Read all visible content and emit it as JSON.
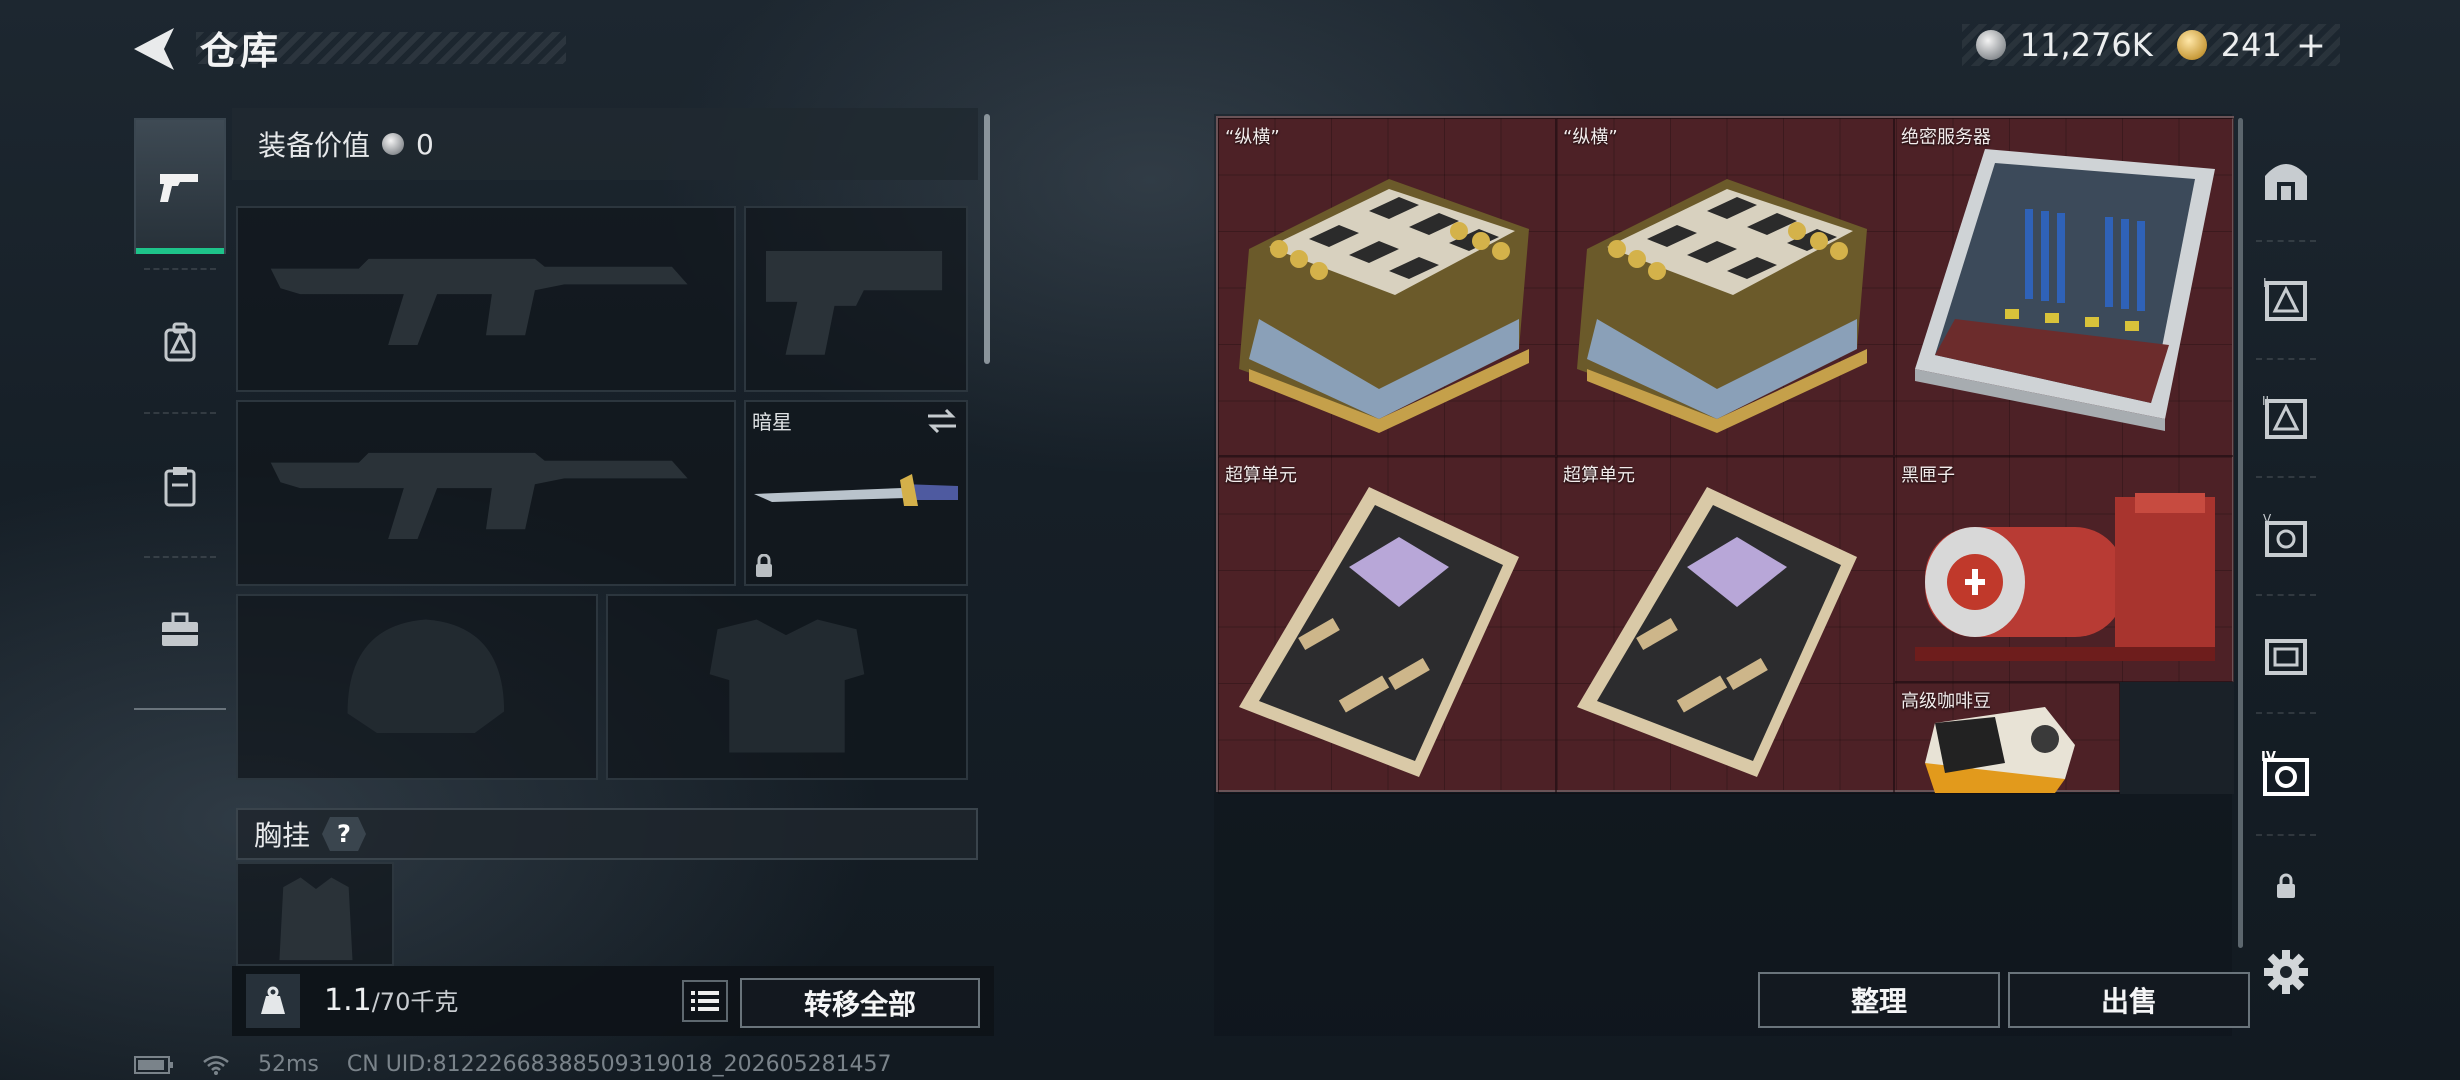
{
  "header": {
    "title": "仓库",
    "silver_amount": "11,276K",
    "gold_amount": "241",
    "add_symbol": "+"
  },
  "side_tabs": [
    "pistol-icon",
    "backpack-icon",
    "clipboard-icon",
    "toolbox-icon"
  ],
  "equipment": {
    "value_label": "装备价值",
    "value_amount": "0",
    "melee_label": "暗星",
    "chest_label": "胸挂",
    "help_symbol": "?",
    "weight_current": "1.1",
    "weight_max": "/70千克",
    "transfer_all": "转移全部"
  },
  "storage": {
    "items": [
      {
        "label": "“纵横”",
        "icon": "chessboard"
      },
      {
        "label": "“纵横”",
        "icon": "chessboard"
      },
      {
        "label": "绝密服务器",
        "icon": "server"
      },
      {
        "label": "超算单元",
        "icon": "circuit-board"
      },
      {
        "label": "超算单元",
        "icon": "circuit-board"
      },
      {
        "label": "黑匣子",
        "icon": "black-box"
      },
      {
        "label": "高级咖啡豆",
        "icon": "coffee-bag"
      }
    ],
    "sort_button": "整理",
    "sell_button": "出售",
    "grid_color": "#4d2126"
  },
  "status": {
    "ping": "52ms",
    "uid": "CN UID:8122266838850931901​8_202605281457"
  },
  "colors": {
    "accent_green": "#1ec38a"
  }
}
